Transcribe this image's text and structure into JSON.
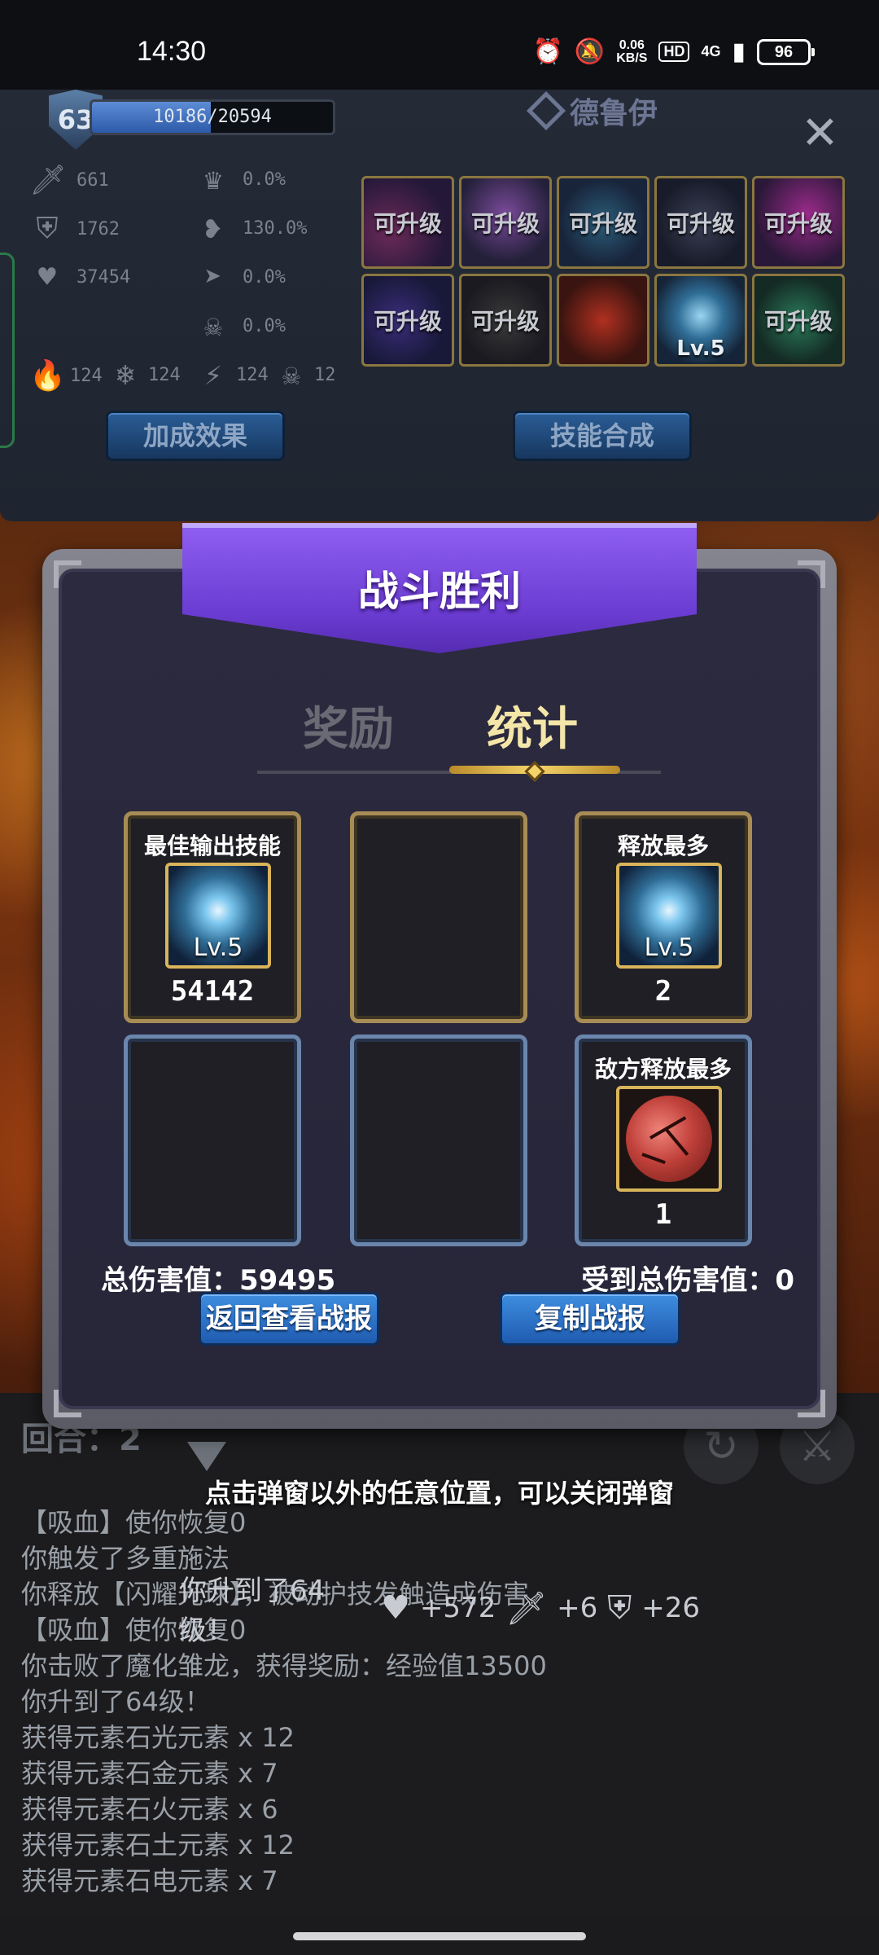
{
  "status_bar": {
    "time": "14:30",
    "net_speed": "0.06",
    "net_unit": "KB/S",
    "hd": "HD",
    "signal": "4G",
    "battery": "96"
  },
  "character": {
    "level": "63",
    "xp_text": "10186/20594",
    "xp_fraction": 0.4946,
    "name": "德鲁伊",
    "close": "✕",
    "stats": {
      "attack": "661",
      "defense": "1762",
      "hp": "37454",
      "crit": "0.0%",
      "lifesteal": "130.0%",
      "dodge": "0.0%",
      "resist": "0.0%",
      "fire": "124",
      "ice": "124",
      "lightning": "124",
      "poison": "12"
    },
    "skills": [
      {
        "label": "可升级",
        "lv": ""
      },
      {
        "label": "可升级",
        "lv": ""
      },
      {
        "label": "可升级",
        "lv": ""
      },
      {
        "label": "可升级",
        "lv": ""
      },
      {
        "label": "可升级",
        "lv": ""
      },
      {
        "label": "可升级",
        "lv": ""
      },
      {
        "label": "可升级",
        "lv": ""
      },
      {
        "label": "",
        "lv": ""
      },
      {
        "label": "",
        "lv": "Lv.5"
      },
      {
        "label": "可升级",
        "lv": ""
      }
    ],
    "bonus_button": "加成效果",
    "synth_button": "技能合成"
  },
  "modal": {
    "title": "战斗胜利",
    "tab_reward": "奖励",
    "tab_stats": "统计",
    "cards": {
      "best_output_title": "最佳输出技能",
      "best_output_lv": "Lv.5",
      "best_output_value": "54142",
      "most_cast_title": "释放最多",
      "most_cast_lv": "Lv.5",
      "most_cast_value": "2",
      "enemy_most_title": "敌方释放最多",
      "enemy_most_value": "1"
    },
    "total_damage": "总伤害值：59495",
    "total_received": "受到总伤害值：0",
    "back_button": "返回查看战报",
    "copy_button": "复制战报"
  },
  "log": {
    "round": "回合：2",
    "close_hint": "点击弹窗以外的任意位置，可以关闭弹窗",
    "lines": [
      "【吸血】使你恢复0",
      "你触发了多重施法",
      "你释放【闪耀光球】，被动护技发触造成伤害",
      "【吸血】使你恢复0",
      "你击败了魔化雏龙，获得奖励：经验值13500",
      "你升到了64级！",
      "获得元素石光元素 x 12",
      "获得元素石金元素 x 7",
      "获得元素石火元素 x 6",
      "获得元素石土元素 x 12",
      "获得元素石电元素 x 7"
    ],
    "levelup_text": "你升到了64级！",
    "levelup_hp": "+572",
    "levelup_atk": "+6",
    "levelup_def": "+26"
  }
}
